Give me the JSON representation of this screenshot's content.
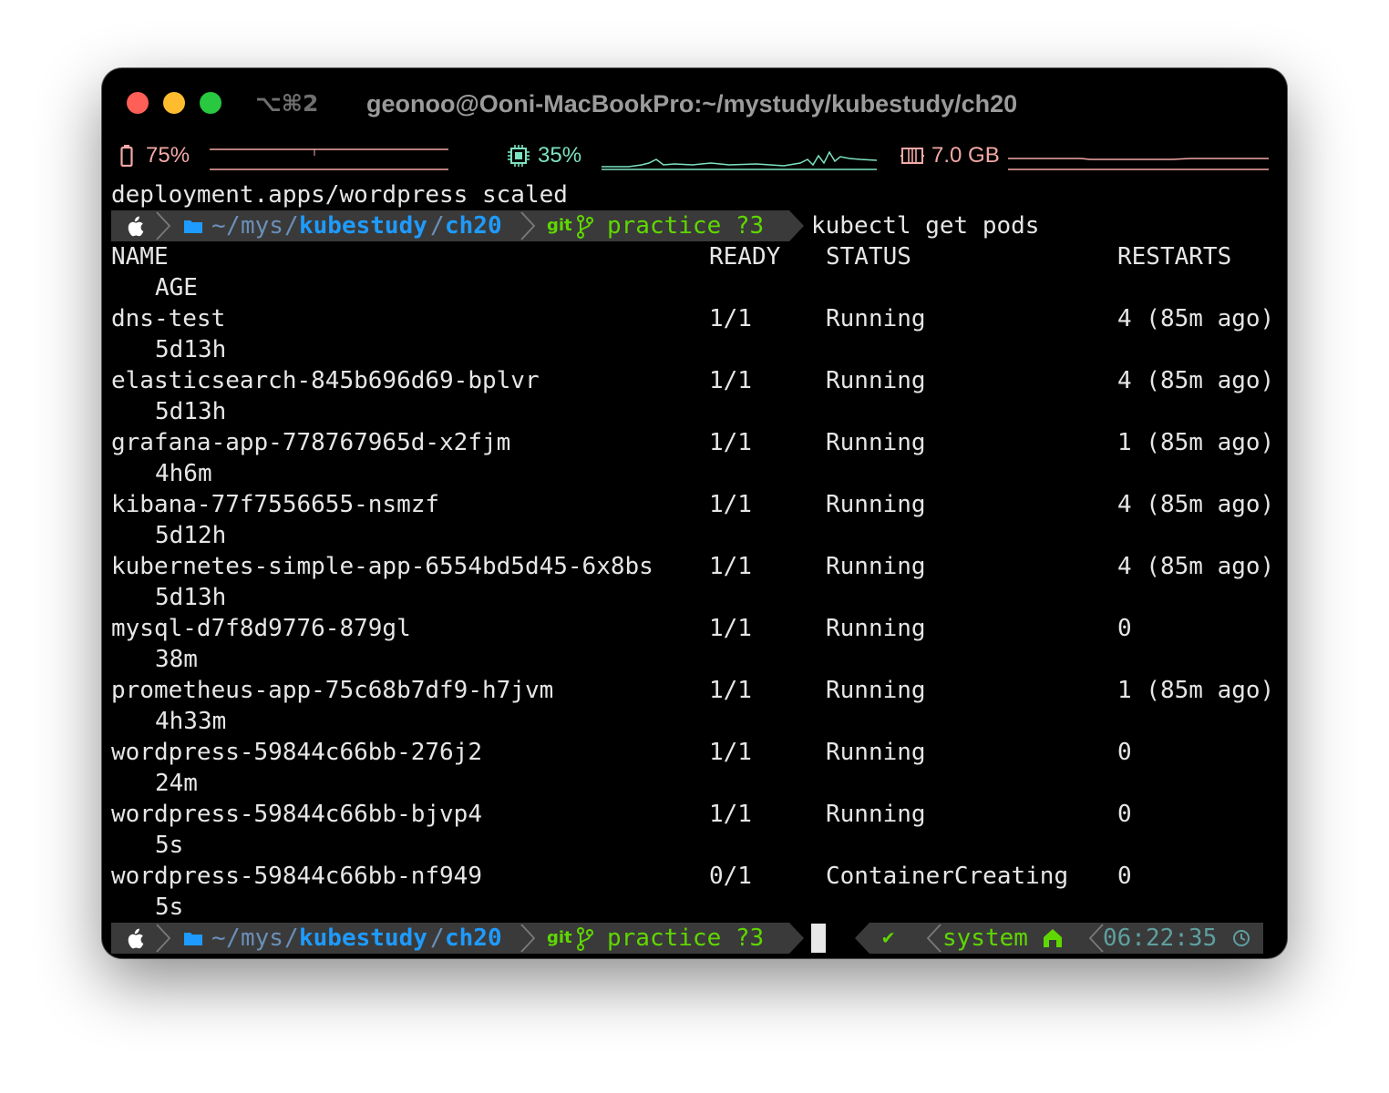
{
  "titlebar": {
    "shortcut": "⌥⌘2",
    "title": "geonoo@Ooni-MacBookPro:~/mystudy/kubestudy/ch20"
  },
  "statusbar": {
    "battery": {
      "icon": "battery-icon",
      "value": "75%",
      "color": "#f3a9a6"
    },
    "cpu": {
      "icon": "cpu-icon",
      "value": "35%",
      "color": "#7de2c0"
    },
    "memory": {
      "icon": "memory-icon",
      "value": "7.0 GB",
      "color": "#f3a9a6"
    }
  },
  "terminal": {
    "output_line": "deployment.apps/wordpress scaled",
    "prompt": {
      "apple_icon": "apple-icon",
      "folder_icon": "folder-icon",
      "path_home": "~",
      "path_mid": "mys",
      "path_sep": "/",
      "path_bold1": "kubestudy",
      "path_bold2": "ch20",
      "git_label": "git",
      "branch_icon": "git-branch-icon",
      "branch": "practice ?3",
      "command": "kubectl get pods"
    },
    "headers": {
      "name": "NAME",
      "ready": "READY",
      "status": "STATUS",
      "restarts": "RESTARTS",
      "age": "AGE"
    },
    "pods": [
      {
        "name": "dns-test",
        "ready": "1/1",
        "status": "Running",
        "restarts": "4 (85m ago)",
        "age": "5d13h"
      },
      {
        "name": "elasticsearch-845b696d69-bplvr",
        "ready": "1/1",
        "status": "Running",
        "restarts": "4 (85m ago)",
        "age": "5d13h"
      },
      {
        "name": "grafana-app-778767965d-x2fjm",
        "ready": "1/1",
        "status": "Running",
        "restarts": "1 (85m ago)",
        "age": "4h6m"
      },
      {
        "name": "kibana-77f7556655-nsmzf",
        "ready": "1/1",
        "status": "Running",
        "restarts": "4 (85m ago)",
        "age": "5d12h"
      },
      {
        "name": "kubernetes-simple-app-6554bd5d45-6x8bs",
        "ready": "1/1",
        "status": "Running",
        "restarts": "4 (85m ago)",
        "age": "5d13h"
      },
      {
        "name": "mysql-d7f8d9776-879gl",
        "ready": "1/1",
        "status": "Running",
        "restarts": "0",
        "age": "38m"
      },
      {
        "name": "prometheus-app-75c68b7df9-h7jvm",
        "ready": "1/1",
        "status": "Running",
        "restarts": "1 (85m ago)",
        "age": "4h33m"
      },
      {
        "name": "wordpress-59844c66bb-276j2",
        "ready": "1/1",
        "status": "Running",
        "restarts": "0",
        "age": "24m"
      },
      {
        "name": "wordpress-59844c66bb-bjvp4",
        "ready": "1/1",
        "status": "Running",
        "restarts": "0",
        "age": "5s"
      },
      {
        "name": "wordpress-59844c66bb-nf949",
        "ready": "0/1",
        "status": "ContainerCreating",
        "restarts": "0",
        "age": "5s"
      }
    ],
    "right_prompt": {
      "check": "✔",
      "env": "system",
      "env_icon": "home-icon",
      "time": "06:22:35",
      "clock_icon": "clock-icon"
    }
  },
  "colors": {
    "prompt_bg": "#3a3a3a",
    "path_blue": "#1e9bff",
    "path_dim": "#6b8fb8",
    "git_green": "#5fd700"
  }
}
